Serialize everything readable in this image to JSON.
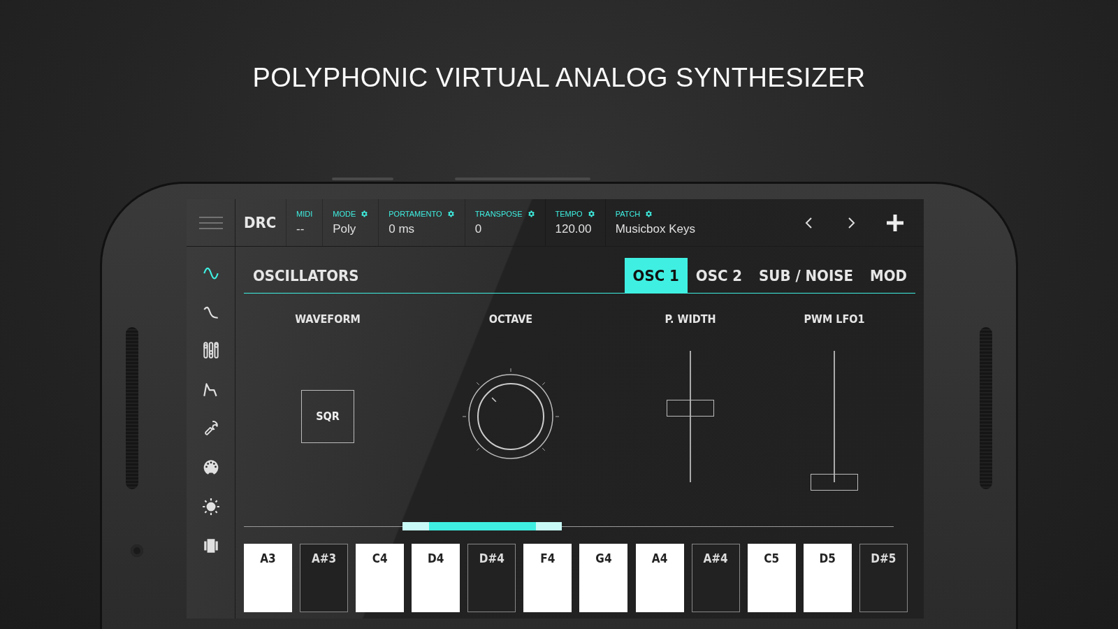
{
  "headline": "POLYPHONIC VIRTUAL ANALOG SYNTHESIZER",
  "header": {
    "brand": "DRC",
    "fields": [
      {
        "label": "MIDI",
        "value": "--",
        "has_settings": false
      },
      {
        "label": "MODE",
        "value": "Poly",
        "has_settings": true
      },
      {
        "label": "PORTAMENTO",
        "value": "0 ms",
        "has_settings": true
      },
      {
        "label": "TRANSPOSE",
        "value": "0",
        "has_settings": true
      },
      {
        "label": "TEMPO",
        "value": "120.00",
        "has_settings": true
      },
      {
        "label": "PATCH",
        "value": "Musicbox Keys",
        "has_settings": true
      }
    ]
  },
  "sidebar": {
    "items": [
      {
        "selected": true
      },
      {
        "selected": false
      },
      {
        "selected": false
      },
      {
        "selected": false
      },
      {
        "selected": false
      },
      {
        "selected": false
      },
      {
        "selected": false
      },
      {
        "selected": false
      }
    ]
  },
  "section": {
    "title": "OSCILLATORS",
    "tabs": [
      {
        "label": "OSC 1",
        "selected": true
      },
      {
        "label": "OSC 2",
        "selected": false
      },
      {
        "label": "SUB / NOISE",
        "selected": false
      },
      {
        "label": "MOD",
        "selected": false
      }
    ]
  },
  "controls": [
    {
      "kind": "button",
      "label": "WAVEFORM",
      "value": "SQR"
    },
    {
      "kind": "knob",
      "label": "OCTAVE"
    },
    {
      "kind": "slider",
      "label": "P. WIDTH",
      "level": 0.56
    },
    {
      "kind": "slider",
      "label": "PWM LFO1",
      "level": 0
    }
  ],
  "keyboard": {
    "keys": [
      {
        "note": "A3",
        "kind": "white"
      },
      {
        "note": "A#3",
        "kind": "black"
      },
      {
        "note": "C4",
        "kind": "white"
      },
      {
        "note": "D4",
        "kind": "white"
      },
      {
        "note": "D#4",
        "kind": "black"
      },
      {
        "note": "F4",
        "kind": "white"
      },
      {
        "note": "G4",
        "kind": "white"
      },
      {
        "note": "A4",
        "kind": "white"
      },
      {
        "note": "A#4",
        "kind": "black"
      },
      {
        "note": "C5",
        "kind": "white"
      },
      {
        "note": "D5",
        "kind": "white"
      },
      {
        "note": "D#5",
        "kind": "black"
      }
    ]
  }
}
